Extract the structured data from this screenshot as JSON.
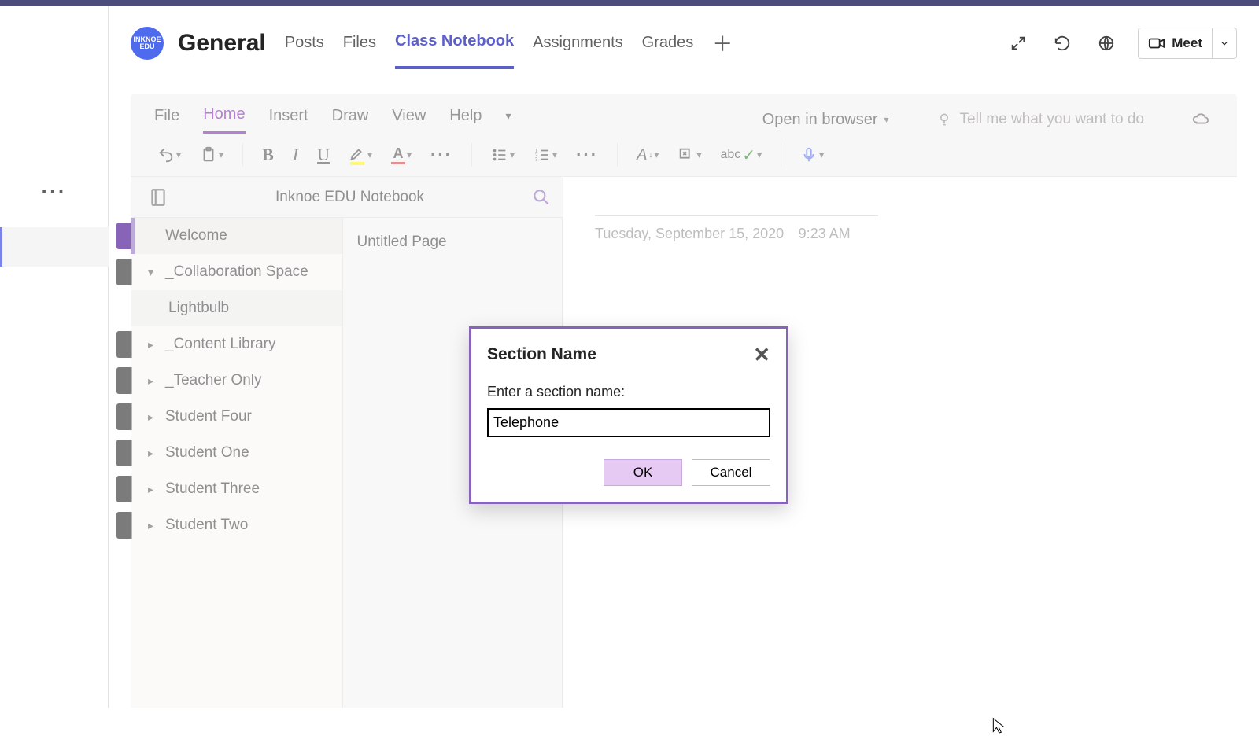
{
  "team": {
    "avatar_text": "INKNOE EDU",
    "channel": "General",
    "tabs": [
      "Posts",
      "Files",
      "Class Notebook",
      "Assignments",
      "Grades"
    ],
    "active_tab_index": 2,
    "meet_label": "Meet"
  },
  "onenote": {
    "menus": [
      "File",
      "Home",
      "Insert",
      "Draw",
      "View",
      "Help"
    ],
    "active_menu_index": 1,
    "open_in_browser": "Open in browser",
    "tellme_placeholder": "Tell me what you want to do",
    "notebook_title": "Inknoe EDU Notebook",
    "sections": [
      {
        "label": "Welcome",
        "expandable": false,
        "expanded": false,
        "selected": true
      },
      {
        "label": "_Collaboration Space",
        "expandable": true,
        "expanded": true
      },
      {
        "label": "Lightbulb",
        "sub": true
      },
      {
        "label": "_Content Library",
        "expandable": true,
        "expanded": false
      },
      {
        "label": "_Teacher Only",
        "expandable": true,
        "expanded": false
      },
      {
        "label": "Student Four",
        "expandable": true,
        "expanded": false
      },
      {
        "label": "Student One",
        "expandable": true,
        "expanded": false
      },
      {
        "label": "Student Three",
        "expandable": true,
        "expanded": false
      },
      {
        "label": "Student Two",
        "expandable": true,
        "expanded": false
      }
    ],
    "pages": [
      {
        "label": "Untitled Page"
      }
    ],
    "page_date": "Tuesday, September 15, 2020",
    "page_time": "9:23 AM"
  },
  "dialog": {
    "title": "Section Name",
    "prompt": "Enter a section name:",
    "value": "Telephone",
    "ok": "OK",
    "cancel": "Cancel"
  }
}
